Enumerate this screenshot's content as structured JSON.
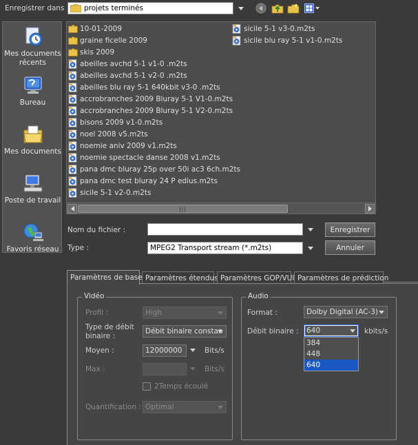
{
  "toolbar": {
    "save_in_label": "Enregistrer dans :",
    "folder": "projets terminés"
  },
  "places": [
    {
      "label": "Mes documents récents",
      "icon": "recent-documents-icon"
    },
    {
      "label": "Bureau",
      "icon": "desktop-icon"
    },
    {
      "label": "Mes documents",
      "icon": "my-documents-icon"
    },
    {
      "label": "Poste de travail",
      "icon": "my-computer-icon"
    },
    {
      "label": "Favoris réseau",
      "icon": "network-places-icon"
    }
  ],
  "files": {
    "col1": [
      {
        "name": "10-01-2009",
        "type": "folder"
      },
      {
        "name": "graine ficelle 2009",
        "type": "folder"
      },
      {
        "name": "skis 2009",
        "type": "folder"
      },
      {
        "name": "abeilles avchd 5-1 v1-0 .m2ts",
        "type": "file"
      },
      {
        "name": "abeilles avchd 5-1 v2-0 .m2ts",
        "type": "file"
      },
      {
        "name": "abeilles blu ray 5-1 640kbit v3-0 .m2ts",
        "type": "file"
      },
      {
        "name": "accrobranches 2009 Bluray 5-1 V1-0.m2ts",
        "type": "file"
      },
      {
        "name": "accrobranches 2009 Bluray 5-1 V2-0.m2ts",
        "type": "file"
      },
      {
        "name": "bisons 2009 v1-0.m2ts",
        "type": "file"
      },
      {
        "name": "noel 2008 v5.m2ts",
        "type": "file"
      },
      {
        "name": "noemie aniv 2009 v1.m2ts",
        "type": "file"
      },
      {
        "name": "noemie spectacle danse 2008 v1.m2ts",
        "type": "file"
      },
      {
        "name": "pana dmc bluray 25p over 50i ac3 6ch.m2ts",
        "type": "file"
      },
      {
        "name": "pana dmc test bluray 24 P edius.m2ts",
        "type": "file"
      },
      {
        "name": "sicile 5-1 v2-0.m2ts",
        "type": "file"
      }
    ],
    "col2": [
      {
        "name": "sicile 5-1 v3-0.m2ts",
        "type": "file"
      },
      {
        "name": "sicile blu ray 5-1 v1-0.m2ts",
        "type": "file"
      }
    ]
  },
  "form": {
    "filename_label": "Nom du fichier :",
    "filename_value": "",
    "type_label": "Type :",
    "type_value": "MPEG2 Transport stream (*.m2ts)",
    "save_button": "Enregistrer",
    "cancel_button": "Annuler"
  },
  "tabs": [
    "Paramètres de base",
    "Paramètres étendus",
    "Paramètres GOP/VUI",
    "Paramètres de prédiction"
  ],
  "video": {
    "title": "Vidéo",
    "profile_label": "Profil :",
    "profile_value": "High",
    "bitrate_type_label": "Type de débit binaire :",
    "bitrate_type_value": "Débit binaire constan",
    "average_label": "Moyen :",
    "average_value": "12000000",
    "average_unit": "Bits/s",
    "max_label": "Max :",
    "max_value": "",
    "max_unit": "Bits/s",
    "twopass_label": "2Temps écoulé",
    "quant_label": "Quantification :",
    "quant_value": "Optimal"
  },
  "audio": {
    "title": "Audio",
    "format_label": "Format :",
    "format_value": "Dolby Digital (AC-3)",
    "bitrate_label": "Débit binaire :",
    "bitrate_value": "640",
    "bitrate_unit": "kbits/s",
    "bitrate_options": [
      "384",
      "448",
      "640"
    ],
    "bitrate_selected_index": 2
  }
}
